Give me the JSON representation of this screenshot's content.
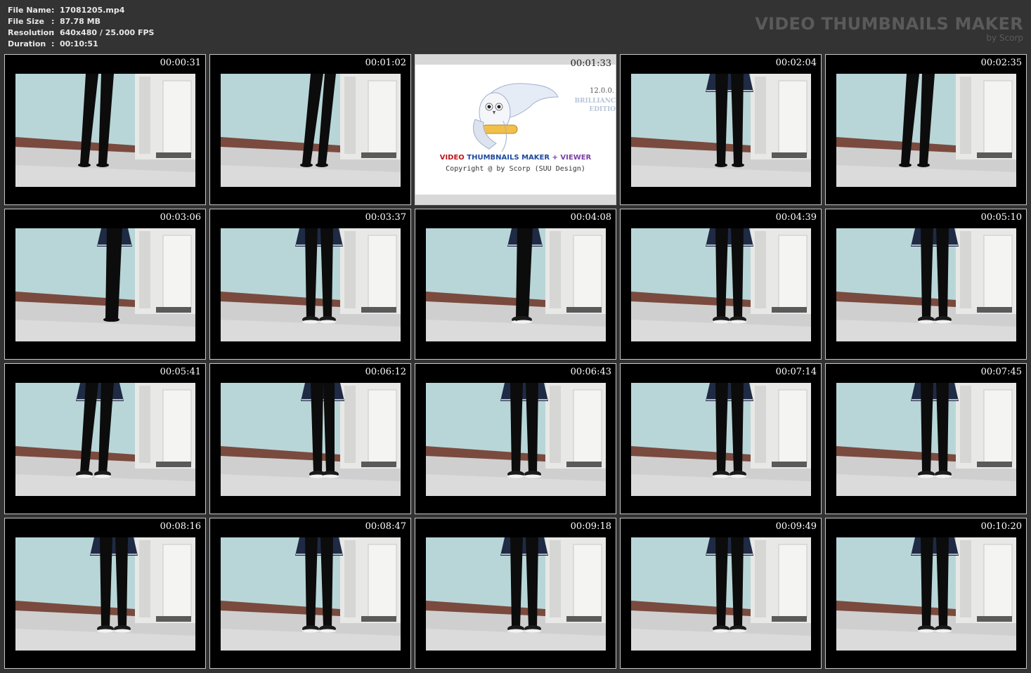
{
  "info": {
    "rows": [
      {
        "key": "File Name",
        "value": "17081205.mp4"
      },
      {
        "key": "File Size",
        "value": "87.78 MB"
      },
      {
        "key": "Resolution",
        "value": "640x480 / 25.000 FPS"
      },
      {
        "key": "Duration",
        "value": "00:10:51"
      }
    ],
    "separator": ":"
  },
  "brand": {
    "title": "VIDEO THUMBNAILS MAKER",
    "subtitle": "by Scorp"
  },
  "logo": {
    "title_part1": "VIDEO",
    "title_part2": "THUMBNAILS MAKER",
    "title_plus": "+",
    "title_part3": "VIEWER",
    "copyright": "Copyright @ by Scorp (SUU Design)",
    "version": "12.0.0.",
    "edition1": "BRILLIANC",
    "edition2": "EDITIO"
  },
  "thumbnails": [
    {
      "time": "00:00:31",
      "skirt": false,
      "shoes": false,
      "pose": "walk"
    },
    {
      "time": "00:01:02",
      "skirt": false,
      "shoes": false,
      "pose": "walk2"
    },
    {
      "time": "00:01:33",
      "logo": true
    },
    {
      "time": "00:02:04",
      "skirt": true,
      "shoes": false,
      "pose": "stand"
    },
    {
      "time": "00:02:35",
      "skirt": false,
      "shoes": false,
      "pose": "walk"
    },
    {
      "time": "00:03:06",
      "skirt": true,
      "shoes": false,
      "pose": "side"
    },
    {
      "time": "00:03:37",
      "skirt": true,
      "shoes": true,
      "pose": "stand"
    },
    {
      "time": "00:04:08",
      "skirt": true,
      "shoes": true,
      "pose": "side"
    },
    {
      "time": "00:04:39",
      "skirt": true,
      "shoes": true,
      "pose": "stand"
    },
    {
      "time": "00:05:10",
      "skirt": true,
      "shoes": true,
      "pose": "stand"
    },
    {
      "time": "00:05:41",
      "skirt": true,
      "shoes": true,
      "pose": "walk"
    },
    {
      "time": "00:06:12",
      "skirt": true,
      "shoes": true,
      "pose": "cross"
    },
    {
      "time": "00:06:43",
      "skirt": true,
      "shoes": true,
      "pose": "stand"
    },
    {
      "time": "00:07:14",
      "skirt": true,
      "shoes": true,
      "pose": "stand"
    },
    {
      "time": "00:07:45",
      "skirt": true,
      "shoes": true,
      "pose": "stand"
    },
    {
      "time": "00:08:16",
      "skirt": true,
      "shoes": true,
      "pose": "stand"
    },
    {
      "time": "00:08:47",
      "skirt": true,
      "shoes": true,
      "pose": "stand"
    },
    {
      "time": "00:09:18",
      "skirt": true,
      "shoes": true,
      "pose": "stand"
    },
    {
      "time": "00:09:49",
      "skirt": true,
      "shoes": true,
      "pose": "stand"
    },
    {
      "time": "00:10:20",
      "skirt": true,
      "shoes": true,
      "pose": "stand"
    }
  ],
  "colors": {
    "background": "#333333",
    "wall": "#b8d6d8",
    "floor": "#cfcfcf",
    "baseboard": "#7a4a3e",
    "door": "#e8e8e6"
  }
}
